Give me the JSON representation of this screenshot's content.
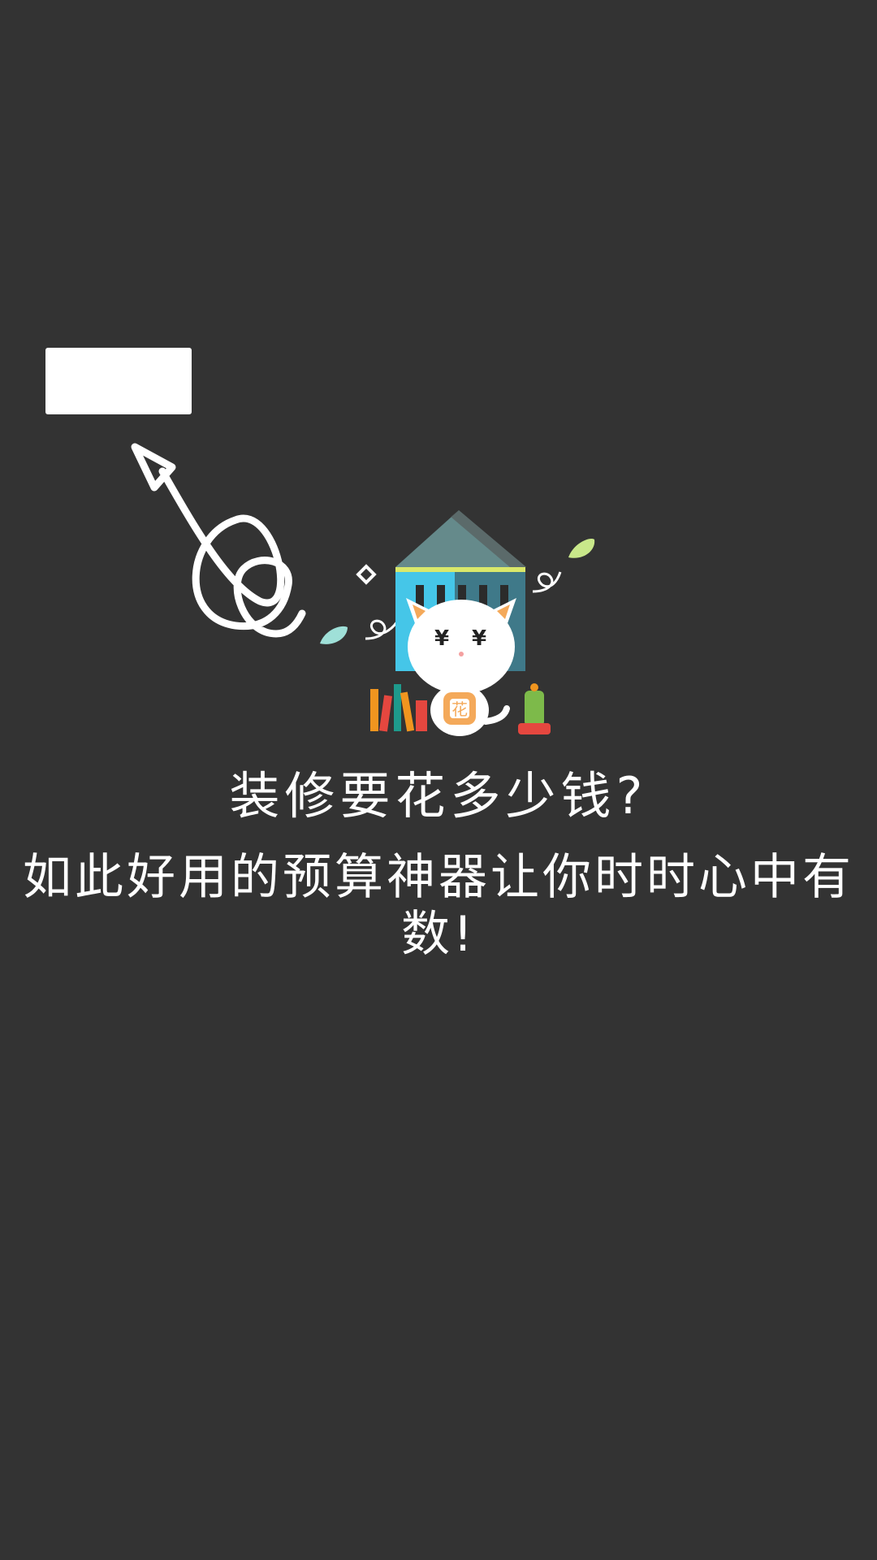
{
  "colors": {
    "background": "#333333",
    "text": "#ffffff",
    "house_roof": "#7fb3b3",
    "house_wall": "#45c6e8",
    "house_stripe": "#d9e86a",
    "book_orange": "#f0951f",
    "book_red": "#e5473f",
    "book_teal": "#1e9a8c",
    "cactus": "#7dba4a",
    "pot": "#e5473f",
    "leaf": "#9fe0d8"
  },
  "icons": {
    "arrow": "curly-arrow-icon",
    "house": "house-icon",
    "cat": "cat-mascot-icon",
    "books": "books-icon",
    "cactus": "cactus-icon",
    "leaf": "leaf-icon",
    "diamond": "diamond-icon"
  },
  "illustration": {
    "cat_eye_symbol": "¥",
    "cat_belly_text": "花"
  },
  "text": {
    "headline": "装修要花多少钱?",
    "subline": "如此好用的预算神器让你时时心中有数!"
  }
}
